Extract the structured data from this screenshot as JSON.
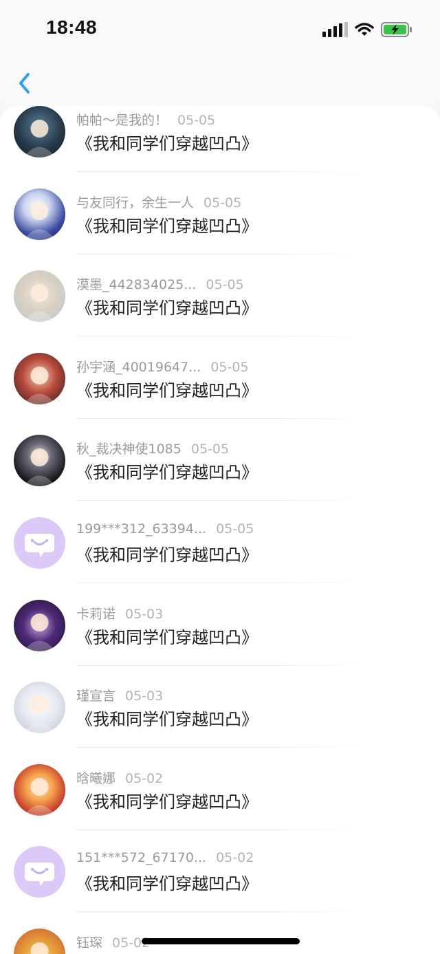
{
  "status_bar": {
    "time": "18:48"
  },
  "items": [
    {
      "name": "帕帕～是我的！",
      "date": "05-05",
      "title": "《我和同学们穿越凹凸》",
      "avatar": "anime-avatar-1"
    },
    {
      "name": "与友同行，余生一人",
      "date": "05-05",
      "title": "《我和同学们穿越凹凸》",
      "avatar": "anime-avatar-2"
    },
    {
      "name": "漠墨_442834025...",
      "date": "05-05",
      "title": "《我和同学们穿越凹凸》",
      "avatar": "anime-avatar-3"
    },
    {
      "name": "孙宇涵_40019647...",
      "date": "05-05",
      "title": "《我和同学们穿越凹凸》",
      "avatar": "anime-avatar-4"
    },
    {
      "name": "秋_裁决神使1085",
      "date": "05-05",
      "title": "《我和同学们穿越凹凸》",
      "avatar": "anime-avatar-5"
    },
    {
      "name": "199***312_63394...",
      "date": "05-05",
      "title": "《我和同学们穿越凹凸》",
      "avatar": "default-chat-avatar"
    },
    {
      "name": "卡莉诺",
      "date": "05-03",
      "title": "《我和同学们穿越凹凸》",
      "avatar": "anime-avatar-6"
    },
    {
      "name": "瑾宣言",
      "date": "05-03",
      "title": "《我和同学们穿越凹凸》",
      "avatar": "anime-avatar-7"
    },
    {
      "name": "晗曦娜",
      "date": "05-02",
      "title": "《我和同学们穿越凹凸》",
      "avatar": "anime-avatar-8"
    },
    {
      "name": "151***572_67170...",
      "date": "05-02",
      "title": "《我和同学们穿越凹凸》",
      "avatar": "default-chat-avatar"
    },
    {
      "name": "钰琛",
      "date": "05-02",
      "title": "",
      "avatar": "anime-avatar-9"
    }
  ],
  "colors": {
    "accent": "#2aa0e8",
    "default_avatar_bg": "#dcc9f7",
    "battery_charge": "#3cc24a"
  }
}
